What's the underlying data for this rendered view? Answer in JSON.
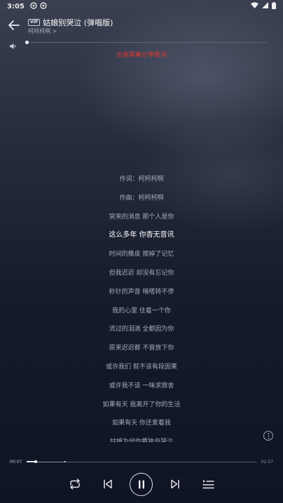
{
  "status_bar": {
    "time": "3:05"
  },
  "header": {
    "vip_badge": "VIP",
    "title": "姑娘别哭泣 (弹唱版)",
    "artist": "柯柯柯啊 >"
  },
  "hint": "长按屏幕分享歌词",
  "lyrics": [
    {
      "text": "作词：柯柯柯啊",
      "active": false
    },
    {
      "text": "作曲：柯柯柯啊",
      "active": false
    },
    {
      "text": "突来的消息 那个人是你",
      "active": false
    },
    {
      "text": "这么多年 你杳无音讯",
      "active": true
    },
    {
      "text": "时间的橡皮 擦掉了记忆",
      "active": false
    },
    {
      "text": "但我迟迟 却没有忘记你",
      "active": false
    },
    {
      "text": "秒针的声音 嘀嗒转不停",
      "active": false
    },
    {
      "text": "我的心里 住着一个你",
      "active": false
    },
    {
      "text": "流过的泪滴 全都因为你",
      "active": false
    },
    {
      "text": "原来迟迟都 不曾放下你",
      "active": false
    },
    {
      "text": "或许我们 就不该有段因果",
      "active": false
    },
    {
      "text": "或许我不该 一味求旅舍",
      "active": false
    },
    {
      "text": "如果有天 我离开了你的生活",
      "active": false
    },
    {
      "text": "如果有天 你还爱着我",
      "active": false
    },
    {
      "text": "姑娘为何你要独自哭泣",
      "active": false
    }
  ],
  "playback": {
    "current_time": "00:07",
    "total_time": "02:57",
    "progress": 0.04,
    "buffered": 0.17,
    "volume": 0.0
  },
  "icons": {
    "back": "arrow-left-icon",
    "volume": "speaker-icon",
    "more": "more-vertical-icon",
    "repeat": "repeat-icon",
    "prev": "skip-previous-icon",
    "pause": "pause-icon",
    "next": "skip-next-icon",
    "playlist": "playlist-icon"
  },
  "colors": {
    "hint": "#e0362f",
    "lyric_active": "#ffffff",
    "lyric_inactive": "#a7acb9"
  }
}
